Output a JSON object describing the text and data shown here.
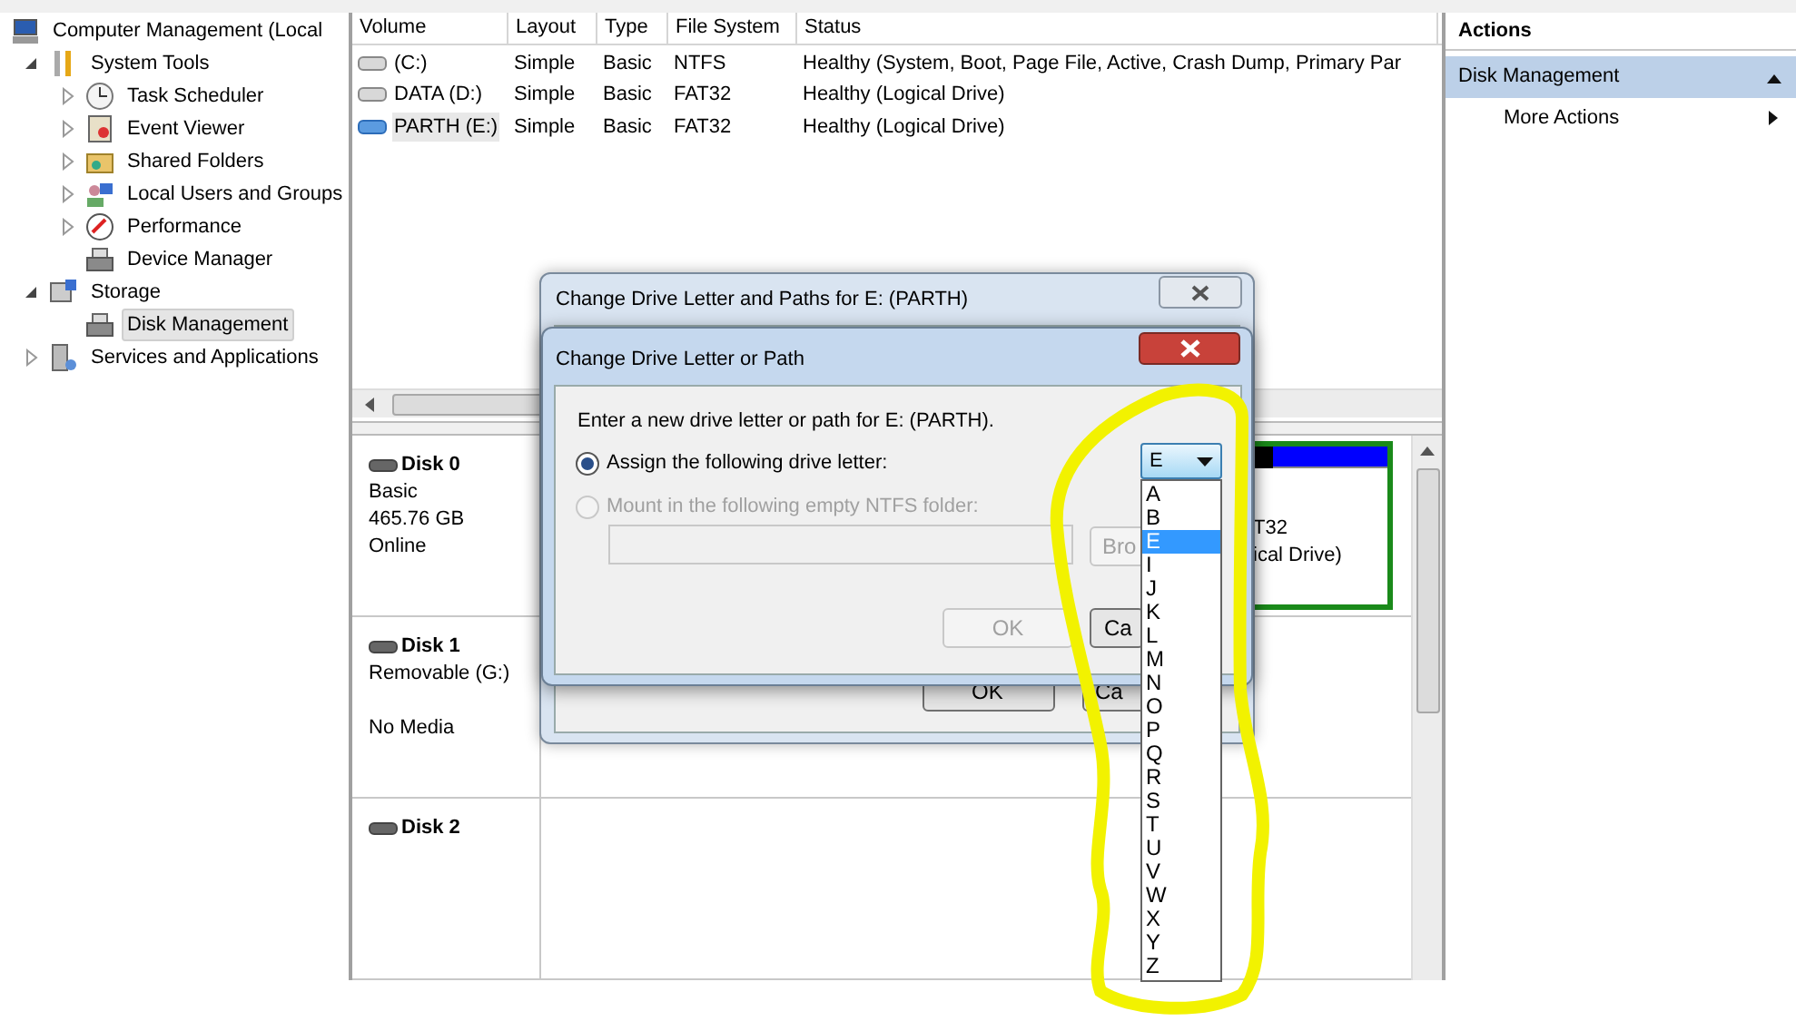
{
  "tree": [
    {
      "label": "Computer Management (Local",
      "kind": "computer",
      "children": [
        {
          "label": "System Tools",
          "kind": "tools",
          "expanded": true,
          "children": [
            {
              "label": "Task Scheduler",
              "kind": "clock",
              "expanded": false
            },
            {
              "label": "Event Viewer",
              "kind": "log",
              "expanded": false
            },
            {
              "label": "Shared Folders",
              "kind": "folder",
              "expanded": false
            },
            {
              "label": "Local Users and Groups",
              "kind": "users",
              "expanded": false
            },
            {
              "label": "Performance",
              "kind": "gauge",
              "expanded": false
            },
            {
              "label": "Device Manager",
              "kind": "device"
            }
          ]
        },
        {
          "label": "Storage",
          "kind": "storage",
          "expanded": true,
          "children": [
            {
              "label": "Disk Management",
              "kind": "device",
              "selected": true
            }
          ]
        },
        {
          "label": "Services and Applications",
          "kind": "server",
          "expanded": false
        }
      ]
    }
  ],
  "volumes": {
    "columns": [
      "Volume",
      "Layout",
      "Type",
      "File System",
      "Status"
    ],
    "rows": [
      {
        "selected": false,
        "cells": [
          "(C:)",
          "Simple",
          "Basic",
          "NTFS",
          "Healthy (System, Boot, Page File, Active, Crash Dump, Primary Par"
        ]
      },
      {
        "selected": false,
        "cells": [
          "DATA (D:)",
          "Simple",
          "Basic",
          "FAT32",
          "Healthy (Logical Drive)"
        ]
      },
      {
        "selected": true,
        "cells": [
          "PARTH (E:)",
          "Simple",
          "Basic",
          "FAT32",
          "Healthy (Logical Drive)"
        ]
      }
    ]
  },
  "disks": [
    {
      "name": "Disk 0",
      "lines": [
        "Basic",
        "465.76 GB",
        "Online"
      ]
    },
    {
      "name": "Disk 1",
      "lines": [
        "Removable (G:)"
      ],
      "status": "No Media"
    },
    {
      "name": "Disk 2"
    }
  ],
  "partition": {
    "lines": [
      "T32",
      "ical Drive)"
    ]
  },
  "actions": {
    "title": "Actions",
    "section": {
      "label": "Disk Management",
      "expanded": true
    },
    "items": [
      {
        "label": "More Actions"
      }
    ]
  },
  "back_dialog": {
    "title": "Change Drive Letter and Paths for E: (PARTH)",
    "buttons": [
      "OK",
      "Ca"
    ]
  },
  "dialog": {
    "title": "Change Drive Letter or Path",
    "prompt": "Enter a new drive letter or path for E: (PARTH).",
    "options": [
      {
        "label": "Assign the following drive letter:",
        "selected": true,
        "disabled": false
      },
      {
        "label": "Mount in the following empty NTFS folder:",
        "selected": false,
        "disabled": true
      }
    ],
    "browse": "Bro",
    "buttons": [
      {
        "label": "OK",
        "disabled": true
      },
      {
        "label": "Ca",
        "disabled": false
      }
    ]
  },
  "dropdown": {
    "value": "E",
    "open": true,
    "items": [
      {
        "label": "A",
        "selected": false
      },
      {
        "label": "B",
        "selected": false
      },
      {
        "label": "E",
        "selected": true
      },
      {
        "label": "I",
        "selected": false
      },
      {
        "label": "J",
        "selected": false
      },
      {
        "label": "K",
        "selected": false
      },
      {
        "label": "L",
        "selected": false
      },
      {
        "label": "M",
        "selected": false
      },
      {
        "label": "N",
        "selected": false
      },
      {
        "label": "O",
        "selected": false
      },
      {
        "label": "P",
        "selected": false
      },
      {
        "label": "Q",
        "selected": false
      },
      {
        "label": "R",
        "selected": false
      },
      {
        "label": "S",
        "selected": false
      },
      {
        "label": "T",
        "selected": false
      },
      {
        "label": "U",
        "selected": false
      },
      {
        "label": "V",
        "selected": false
      },
      {
        "label": "W",
        "selected": false
      },
      {
        "label": "X",
        "selected": false
      },
      {
        "label": "Y",
        "selected": false
      },
      {
        "label": "Z",
        "selected": false
      }
    ]
  },
  "annotation": {
    "kind": "freehand_loop"
  }
}
